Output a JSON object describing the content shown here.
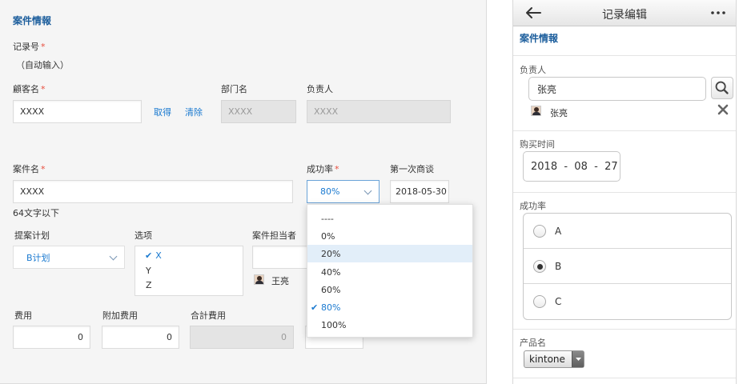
{
  "desktop": {
    "section_title": "案件情報",
    "record_no": {
      "label": "记录号",
      "required": "*",
      "value": "（自动输入）"
    },
    "customer": {
      "label": "顧客名",
      "required": "*",
      "value": "XXXX",
      "get_link": "取得",
      "clear_link": "清除"
    },
    "department": {
      "label": "部门名",
      "value": "XXXX"
    },
    "person": {
      "label": "负责人",
      "value": "XXXX"
    },
    "case_name": {
      "label": "案件名",
      "required": "*",
      "value": "XXXX",
      "hint": "64文字以下"
    },
    "success_rate": {
      "label": "成功率",
      "required": "*",
      "value": "80%"
    },
    "first_meeting": {
      "label": "第一次商谈",
      "value": "2018-05-30"
    },
    "proposal_plan": {
      "label": "提案计划",
      "value": "B计划"
    },
    "options": {
      "label": "选项",
      "items": [
        "X",
        "Y",
        "Z"
      ],
      "checked": "✔"
    },
    "case_owner": {
      "label": "案件担当者",
      "user": "王亮"
    },
    "cost": {
      "label": "费用",
      "value": "0"
    },
    "extra_cost": {
      "label": "附加费用",
      "value": "0"
    },
    "total_cost": {
      "label": "合計費用",
      "value": "0"
    },
    "rate_dropdown": {
      "options": [
        "----",
        "0%",
        "20%",
        "40%",
        "60%",
        "80%",
        "100%"
      ],
      "highlighted": "20%",
      "selected": "80%",
      "check": "✔"
    }
  },
  "mobile": {
    "header_title": "记录编辑",
    "section_title": "案件情報",
    "person": {
      "label": "负责人",
      "input_value": "张亮",
      "user": "张亮"
    },
    "purchase_time": {
      "label": "购买时间",
      "value": "2018  -  08  -  27"
    },
    "success_rate": {
      "label": "成功率",
      "options": [
        "A",
        "B",
        "C"
      ],
      "selected": "B"
    },
    "product": {
      "label": "产品名",
      "value": "kintone"
    }
  },
  "icons": [
    "back-arrow-icon",
    "more-icon",
    "search-icon",
    "close-icon",
    "chevron-down-icon",
    "checkmark-icon"
  ],
  "colors": {
    "accent": "#1b7ad0",
    "title": "#1b5d9c",
    "required": "#e74c3c",
    "highlight": "#e2eef9"
  }
}
